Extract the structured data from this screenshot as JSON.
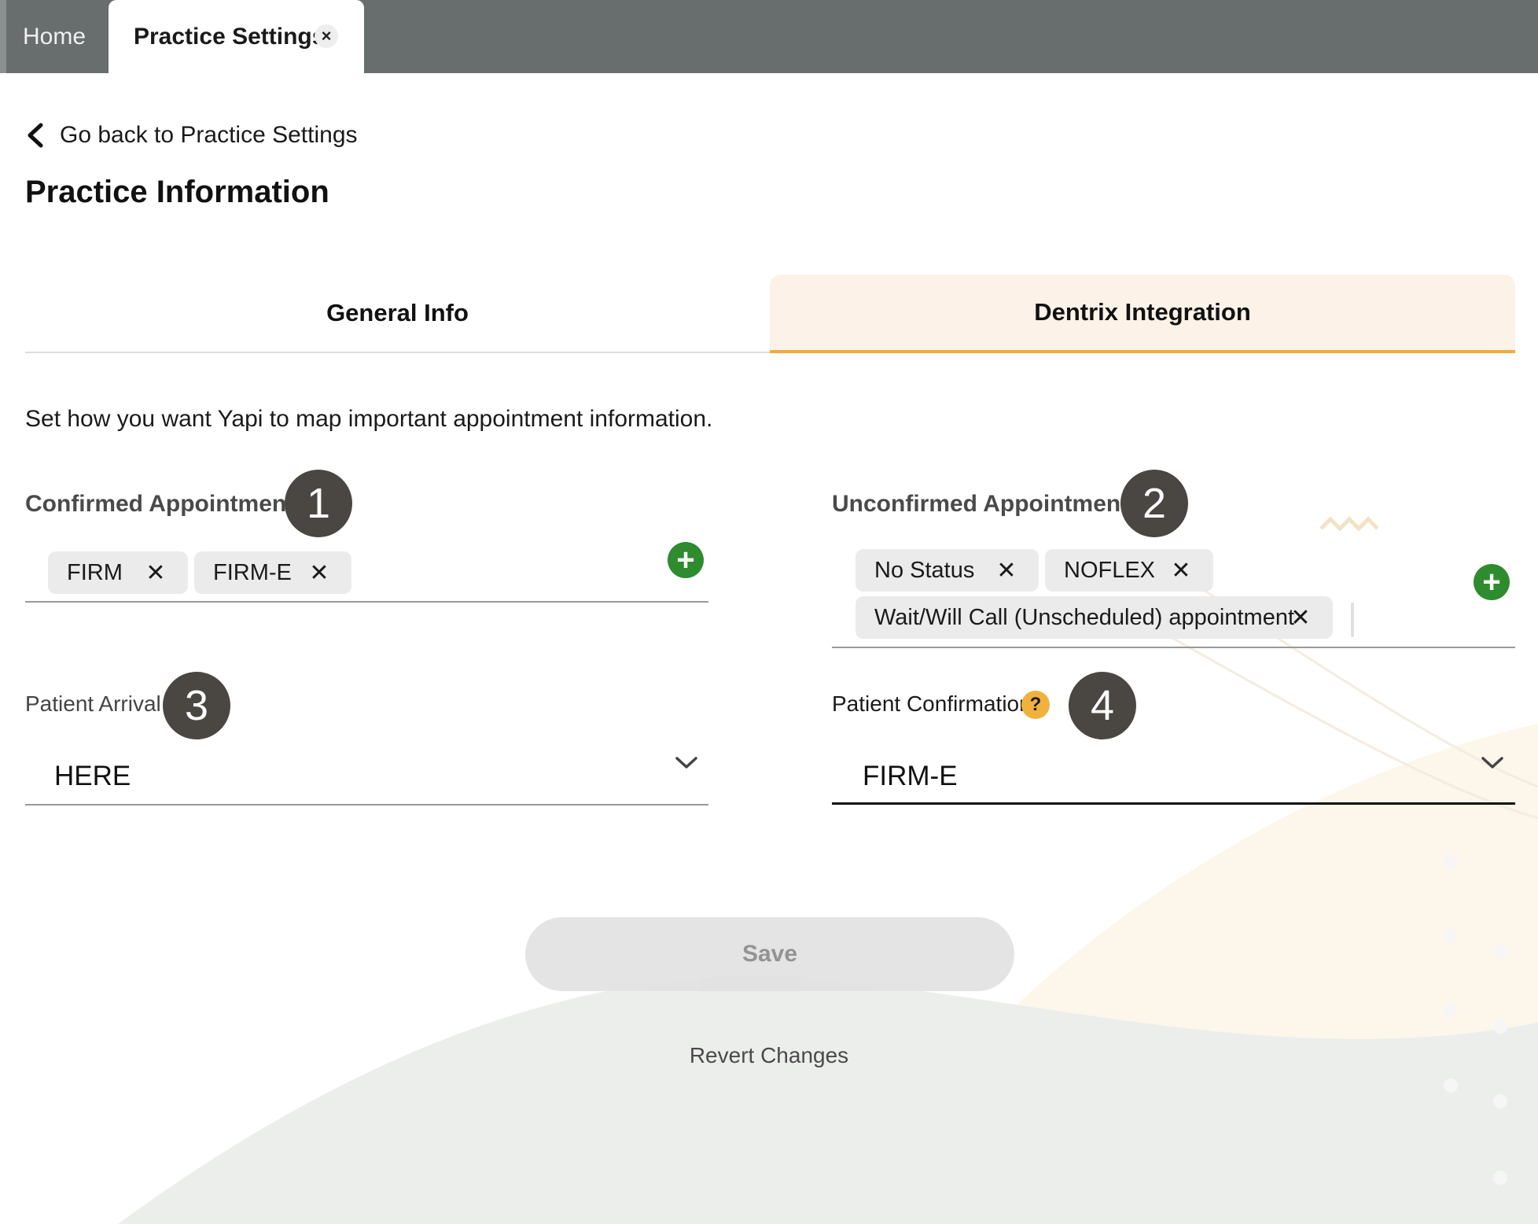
{
  "tabs": {
    "home_label": "Home",
    "practice_label": "Practice Settings",
    "close_glyph": "×"
  },
  "header": {
    "back_label": "Go back to Practice Settings",
    "title": "Practice Information"
  },
  "subtabs": {
    "general_label": "General Info",
    "dentrix_label": "Dentrix Integration",
    "active": "Dentrix Integration"
  },
  "instructions": "Set how you want Yapi to map important appointment information.",
  "confirmed": {
    "label": "Confirmed Appointments",
    "step": "1",
    "chips": [
      "FIRM",
      "FIRM-E"
    ],
    "add_glyph": "+"
  },
  "unconfirmed": {
    "label": "Unconfirmed Appointments",
    "step": "2",
    "chips": [
      "No Status",
      "NOFLEX",
      "Wait/Will Call (Unscheduled) appointment"
    ],
    "add_glyph": "+"
  },
  "arrival": {
    "label": "Patient Arrival",
    "step": "3",
    "value": "HERE"
  },
  "confirmation": {
    "label": "Patient Confirmation",
    "step": "4",
    "help_glyph": "?",
    "value": "FIRM-E"
  },
  "chip_remove_glyph": "✕",
  "actions": {
    "save_label": "Save",
    "revert_label": "Revert Changes"
  },
  "colors": {
    "accent": "#f0ad3c",
    "add_green": "#2e8b2e",
    "badge": "#4a4642",
    "topbar": "#686d6d"
  }
}
